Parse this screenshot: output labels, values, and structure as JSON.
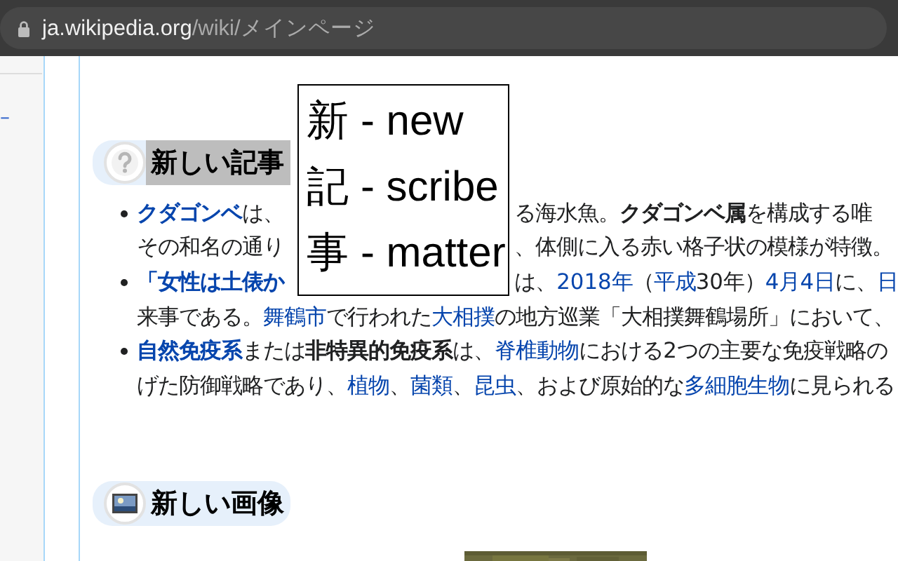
{
  "address_bar": {
    "host": "ja.wikipedia.org",
    "path": "/wiki/メインページ"
  },
  "sidebar": {
    "items": [
      {
        "label": "–"
      }
    ]
  },
  "sections": [
    {
      "kind": "articles",
      "title": "新しい記事",
      "title_selected": true,
      "items": [
        {
          "lines": [
            {
              "parts": [
                [
                  {
                    "text": "クダゴンベ",
                    "link": true,
                    "bold": true
                  },
                  {
                    "text": "は、"
                  }
                ],
                [
                  {
                    "text": "る海水魚。"
                  },
                  {
                    "text": "クダゴンベ属",
                    "bold": true
                  },
                  {
                    "text": "を構成する唯"
                  }
                ]
              ]
            },
            {
              "parts": [
                [
                  {
                    "text": "その和名の通り"
                  }
                ],
                [
                  {
                    "text": "、体側に入る赤い格子状の模様が特徴。"
                  }
                ]
              ]
            }
          ]
        },
        {
          "lines": [
            {
              "parts": [
                [
                  {
                    "text": "「女性は土俵か",
                    "link": true,
                    "bold": true
                  }
                ],
                [
                  {
                    "text": "は、"
                  },
                  {
                    "text": "2018年",
                    "link": true
                  },
                  {
                    "text": "（"
                  },
                  {
                    "text": "平成",
                    "link": true
                  },
                  {
                    "text": "30年）"
                  },
                  {
                    "text": "4月4日",
                    "link": true
                  },
                  {
                    "text": "に、"
                  },
                  {
                    "text": "日",
                    "link": true
                  }
                ]
              ]
            },
            {
              "parts": [
                [
                  {
                    "text": "来事である。"
                  },
                  {
                    "text": "舞鶴市",
                    "link": true
                  },
                  {
                    "text": "で行われた"
                  },
                  {
                    "text": "大相撲",
                    "link": true
                  },
                  {
                    "text": "の地方巡業「大相撲舞鶴場所」において、"
                  }
                ]
              ]
            }
          ]
        },
        {
          "lines": [
            {
              "parts": [
                [
                  {
                    "text": "自然免疫系",
                    "link": true,
                    "bold": true
                  },
                  {
                    "text": "または"
                  },
                  {
                    "text": "非特異的免疫系",
                    "bold": true
                  },
                  {
                    "text": "は、"
                  },
                  {
                    "text": "脊椎動物",
                    "link": true
                  },
                  {
                    "text": "における2つの主要な免疫戦略の"
                  }
                ]
              ]
            },
            {
              "parts": [
                [
                  {
                    "text": "げた防御戦略であり、"
                  },
                  {
                    "text": "植物",
                    "link": true
                  },
                  {
                    "text": "、"
                  },
                  {
                    "text": "菌類",
                    "link": true
                  },
                  {
                    "text": "、"
                  },
                  {
                    "text": "昆虫",
                    "link": true
                  },
                  {
                    "text": "、および原始的な"
                  },
                  {
                    "text": "多細胞生物",
                    "link": true
                  },
                  {
                    "text": "に見られる"
                  }
                ]
              ]
            }
          ]
        }
      ]
    },
    {
      "kind": "images",
      "title": "新しい画像",
      "title_selected": false
    }
  ],
  "popup": {
    "lines": [
      "新 - new",
      "記 - scribe",
      "事 - matter"
    ]
  }
}
